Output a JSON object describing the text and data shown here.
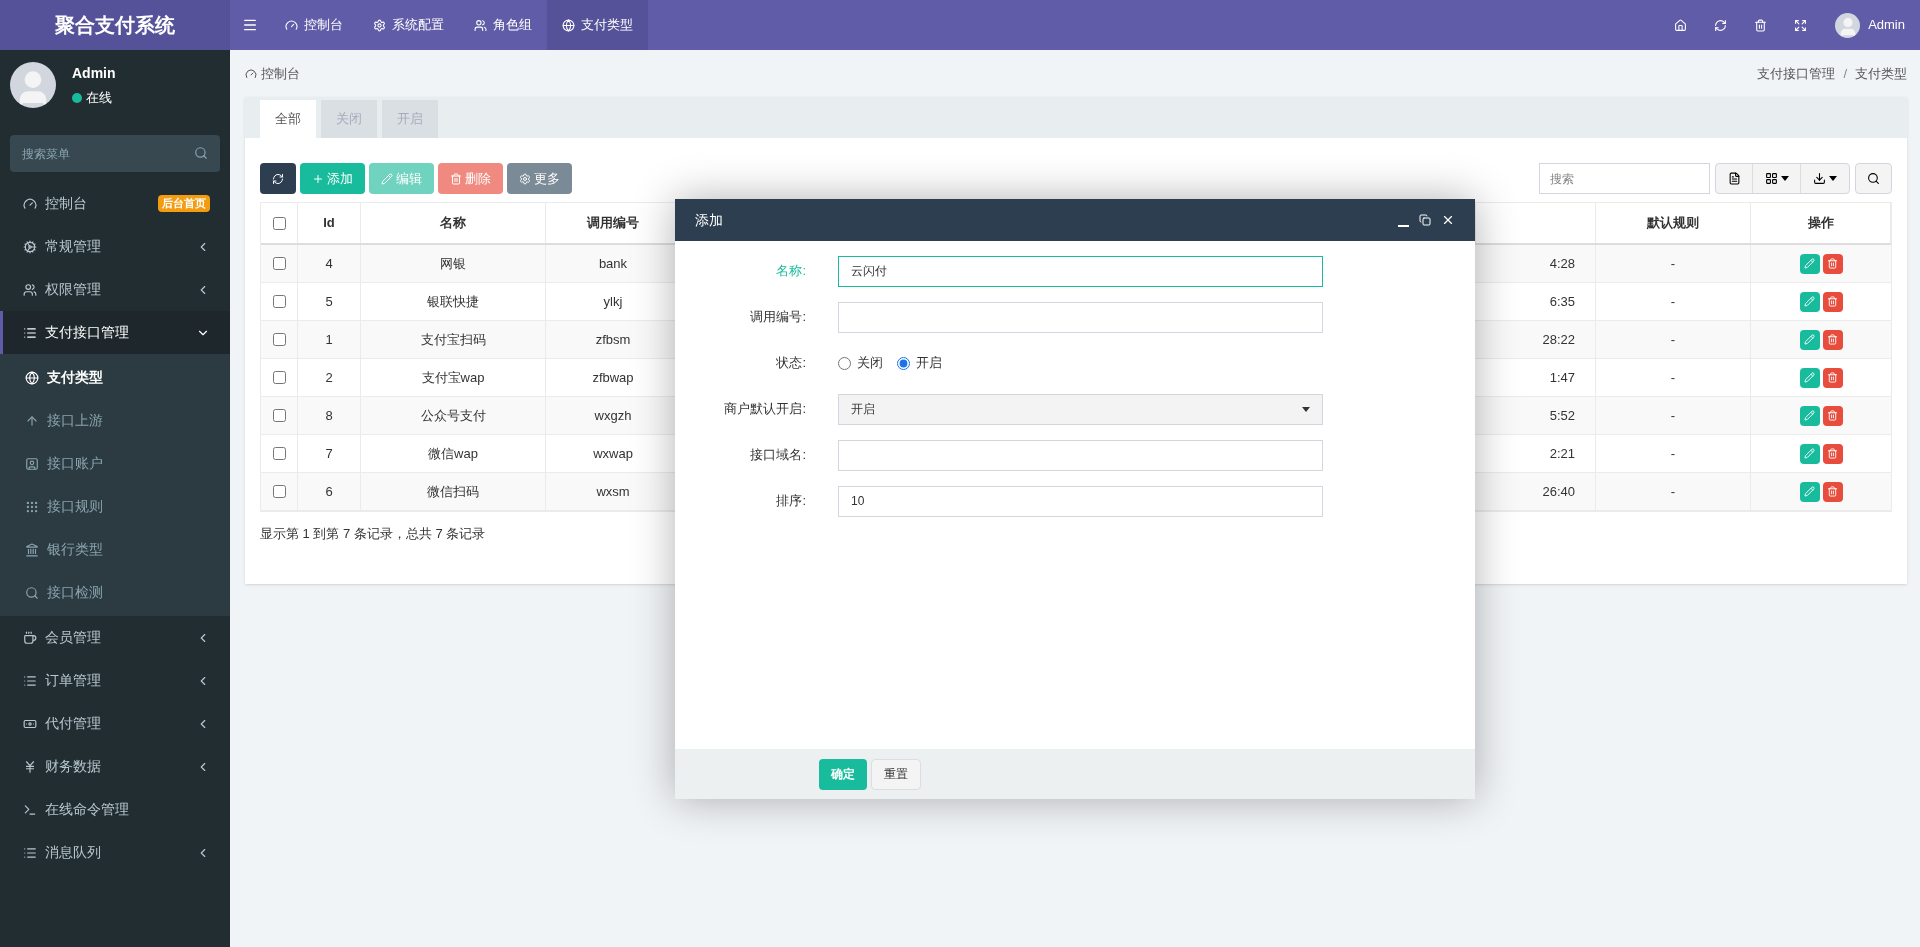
{
  "brand": "聚合支付系统",
  "top_nav": [
    {
      "label": "控制台",
      "selected": false
    },
    {
      "label": "系统配置",
      "selected": false
    },
    {
      "label": "角色组",
      "selected": false
    },
    {
      "label": "支付类型",
      "selected": true
    }
  ],
  "top_user": "Admin",
  "user_panel": {
    "name": "Admin",
    "status": "在线"
  },
  "sidebar_search": {
    "placeholder": "搜索菜单"
  },
  "sidebar": [
    {
      "label": "控制台",
      "kind": "link",
      "badge": "后台首页",
      "selected": false
    },
    {
      "label": "常规管理",
      "kind": "group",
      "expanded": false,
      "selected": false
    },
    {
      "label": "权限管理",
      "kind": "group",
      "expanded": false,
      "selected": false
    },
    {
      "label": "支付接口管理",
      "kind": "group",
      "expanded": true,
      "selected": true,
      "children": [
        {
          "label": "支付类型",
          "selected": true
        },
        {
          "label": "接口上游",
          "selected": false
        },
        {
          "label": "接口账户",
          "selected": false
        },
        {
          "label": "接口规则",
          "selected": false
        },
        {
          "label": "银行类型",
          "selected": false
        },
        {
          "label": "接口检测",
          "selected": false
        }
      ]
    },
    {
      "label": "会员管理",
      "kind": "group",
      "expanded": false,
      "selected": false
    },
    {
      "label": "订单管理",
      "kind": "group",
      "expanded": false,
      "selected": false
    },
    {
      "label": "代付管理",
      "kind": "group",
      "expanded": false,
      "selected": false
    },
    {
      "label": "财务数据",
      "kind": "group",
      "expanded": false,
      "selected": false
    },
    {
      "label": "在线命令管理",
      "kind": "link",
      "selected": false
    },
    {
      "label": "消息队列",
      "kind": "group",
      "expanded": false,
      "selected": false
    }
  ],
  "breadcrumb": {
    "home": "控制台",
    "trail": [
      "支付接口管理",
      "支付类型"
    ],
    "separator": "/"
  },
  "tabs": [
    {
      "label": "全部",
      "selected": true
    },
    {
      "label": "关闭",
      "selected": false
    },
    {
      "label": "开启",
      "selected": false
    }
  ],
  "toolbar": [
    {
      "kind": "refresh",
      "disabled": false
    },
    {
      "kind": "add",
      "label": "添加",
      "disabled": false
    },
    {
      "kind": "edit",
      "label": "编辑",
      "disabled": true
    },
    {
      "kind": "delete",
      "label": "删除",
      "disabled": true
    },
    {
      "kind": "more",
      "label": "更多",
      "disabled": false
    }
  ],
  "table_search": {
    "placeholder": "搜索"
  },
  "table": {
    "header_checked": false,
    "columns": [
      "Id",
      "名称",
      "调用编号",
      "默认规则",
      "操作"
    ],
    "rows": [
      {
        "checked": false,
        "id": "4",
        "name": "网银",
        "code": "bank",
        "column_5": "4:28",
        "default_rule": "-"
      },
      {
        "checked": false,
        "id": "5",
        "name": "银联快捷",
        "code": "ylkj",
        "column_5": "6:35",
        "default_rule": "-"
      },
      {
        "checked": false,
        "id": "1",
        "name": "支付宝扫码",
        "code": "zfbsm",
        "column_5": "28:22",
        "default_rule": "-"
      },
      {
        "checked": false,
        "id": "2",
        "name": "支付宝wap",
        "code": "zfbwap",
        "column_5": "1:47",
        "default_rule": "-"
      },
      {
        "checked": false,
        "id": "8",
        "name": "公众号支付",
        "code": "wxgzh",
        "column_5": "5:52",
        "default_rule": "-"
      },
      {
        "checked": false,
        "id": "7",
        "name": "微信wap",
        "code": "wxwap",
        "column_5": "2:21",
        "default_rule": "-"
      },
      {
        "checked": false,
        "id": "6",
        "name": "微信扫码",
        "code": "wxsm",
        "column_5": "26:40",
        "default_rule": "-"
      }
    ]
  },
  "table_footer": "显示第 1 到第 7 条记录，总共 7 条记录",
  "modal": {
    "title": "添加",
    "fields": [
      {
        "kind": "text",
        "label": "名称:",
        "value": "云闪付",
        "focused": true
      },
      {
        "kind": "text",
        "label": "调用编号:",
        "focused": false
      },
      {
        "kind": "radio",
        "label": "状态:",
        "focused": false,
        "options": [
          {
            "label": "关闭",
            "selected": false
          },
          {
            "label": "开启",
            "selected": true
          }
        ]
      },
      {
        "kind": "select",
        "label": "商户默认开启:",
        "value": "开启",
        "focused": false
      },
      {
        "kind": "text",
        "label": "接口域名:",
        "focused": false
      },
      {
        "kind": "text",
        "label": "排序:",
        "value": "10",
        "focused": false
      }
    ],
    "buttons": [
      {
        "kind": "primary",
        "label": "确定"
      },
      {
        "kind": "default",
        "label": "重置"
      }
    ]
  }
}
